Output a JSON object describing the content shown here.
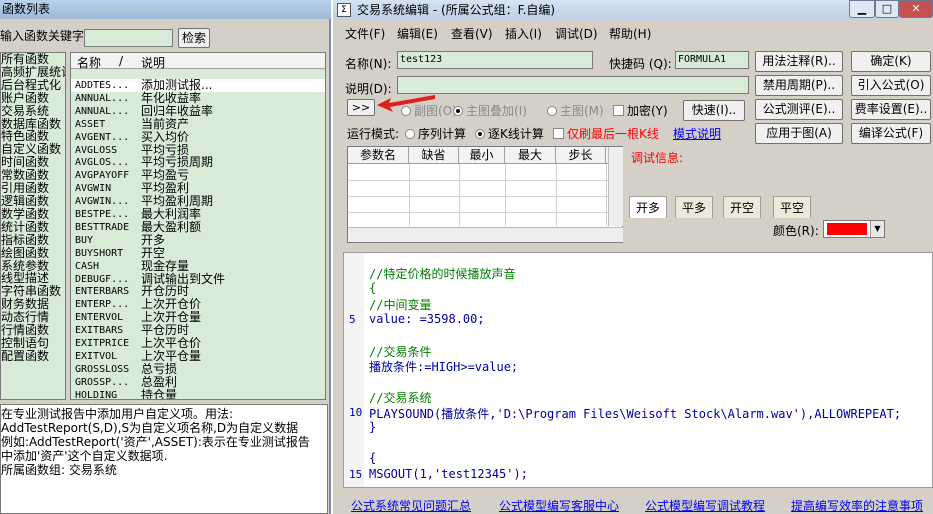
{
  "left": {
    "title": "函数列表",
    "search_label": "输入函数关键字",
    "search_value": "",
    "search_button": "检索",
    "categories": [
      "所有函数",
      "高频扩展统计",
      "后台程式化",
      "账户函数",
      "交易系统",
      "数据库函数",
      "特色函数",
      "自定义函数",
      "时间函数",
      "常数函数",
      "引用函数",
      "逻辑函数",
      "数学函数",
      "统计函数",
      "指标函数",
      "绘图函数",
      "系统参数",
      "线型描述",
      "字符串函数",
      "财务数据",
      "动态行情",
      "行情函数",
      "控制语句",
      "配置函数"
    ],
    "list_header_name": "名称",
    "list_header_slash": "/",
    "list_header_desc": "说明",
    "functions": [
      {
        "name": "ADDTES...",
        "desc": "添加测试报..."
      },
      {
        "name": "ANNUAL...",
        "desc": "年化收益率"
      },
      {
        "name": "ANNUAL...",
        "desc": "回归年收益率"
      },
      {
        "name": "ASSET",
        "desc": "当前资产"
      },
      {
        "name": "AVGENT...",
        "desc": "买入均价"
      },
      {
        "name": "AVGLOSS",
        "desc": "平均亏损"
      },
      {
        "name": "AVGLOS...",
        "desc": "平均亏损周期"
      },
      {
        "name": "AVGPAYOFF",
        "desc": "平均盈亏"
      },
      {
        "name": "AVGWIN",
        "desc": "平均盈利"
      },
      {
        "name": "AVGWIN...",
        "desc": "平均盈利周期"
      },
      {
        "name": "BESTPE...",
        "desc": "最大利润率"
      },
      {
        "name": "BESTTRADE",
        "desc": "最大盈利额"
      },
      {
        "name": "BUY",
        "desc": "开多"
      },
      {
        "name": "BUYSHORT",
        "desc": "开空"
      },
      {
        "name": "CASH",
        "desc": "现金存量"
      },
      {
        "name": "DEBUGF...",
        "desc": "调试输出到文件"
      },
      {
        "name": "ENTERBARS",
        "desc": "开仓历时"
      },
      {
        "name": "ENTERP...",
        "desc": "上次开仓价"
      },
      {
        "name": "ENTERVOL",
        "desc": "上次开仓量"
      },
      {
        "name": "EXITBARS",
        "desc": "平仓历时"
      },
      {
        "name": "EXITPRICE",
        "desc": "上次平仓价"
      },
      {
        "name": "EXITVOL",
        "desc": "上次平仓量"
      },
      {
        "name": "GROSSLOSS",
        "desc": "总亏损"
      },
      {
        "name": "GROSSP...",
        "desc": "总盈利"
      },
      {
        "name": "HOLDING",
        "desc": "持仓量"
      }
    ],
    "desc_lines": [
      "在专业测试报告中添加用户自定义项。用法:",
      "AddTestReport(S,D),S为自定义项名称,D为自定义数据",
      "例如:AddTestReport('资产',ASSET):表示在专业测试报告",
      "中添加'资产'这个自定义数据项.",
      "所属函数组: 交易系统"
    ]
  },
  "right": {
    "title": "交易系统编辑 - (所属公式组：F.自编)",
    "window_buttons": {
      "min": "▁",
      "max": "□",
      "close": "✕"
    },
    "menu": [
      "文件(F)",
      "编辑(E)",
      "查看(V)",
      "插入(I)",
      "调试(D)",
      "帮助(H)"
    ],
    "name_label": "名称(N):",
    "name_value": "test123",
    "shortcut_label": "快捷码 (Q):",
    "shortcut_value": "FORMULA1",
    "desc_label": "说明(D):",
    "desc_value": "",
    "expand_button": ">>",
    "opt_subplot": "副图(O)",
    "opt_main_overlay": "主图叠加(I)",
    "opt_main": "主图(M)",
    "opt_encrypt": "加密(Y)",
    "quick_button": "快速(I)..",
    "run_mode_label": "运行模式:",
    "run_seq": "序列计算",
    "run_tick": "逐K线计算",
    "refresh_last": "仅刷最后一根K线",
    "mode_help": "模式说明",
    "param_headers": [
      "参数名",
      "缺省",
      "最小",
      "最大",
      "步长"
    ],
    "debug_label": "调试信息:",
    "tabs": [
      "开多",
      "平多",
      "开空",
      "平空"
    ],
    "color_label": "颜色(R):",
    "color_value": "#ff0000",
    "buttons_col1": [
      "用法注释(R)..",
      "禁用周期(P)..",
      "公式测评(E)..",
      "应用于图(A)"
    ],
    "buttons_col2": [
      "确定(K)",
      "引入公式(O)",
      "费率设置(E)..",
      "编译公式(F)"
    ],
    "code_lines": [
      {
        "num": "",
        "text": "//特定价格的时候播放声音",
        "cls": "comment"
      },
      {
        "num": "",
        "text": "{",
        "cls": "comment"
      },
      {
        "num": "",
        "text": "//中间变量",
        "cls": "comment"
      },
      {
        "num": "5",
        "text": "value: =3598.00;",
        "cls": "kw"
      },
      {
        "num": "",
        "text": "",
        "cls": "kw"
      },
      {
        "num": "",
        "text": "//交易条件",
        "cls": "comment"
      },
      {
        "num": "",
        "text": "播放条件:=HIGH>=value;",
        "cls": "kw"
      },
      {
        "num": "",
        "text": "",
        "cls": "kw"
      },
      {
        "num": "",
        "text": "//交易系统",
        "cls": "comment"
      },
      {
        "num": "10",
        "text": "PLAYSOUND(播放条件,'D:\\Program Files\\Weisoft Stock\\Alarm.wav'),ALLOWREPEAT;",
        "cls": "kw"
      },
      {
        "num": "",
        "text": "}",
        "cls": "kw"
      },
      {
        "num": "",
        "text": "",
        "cls": "kw"
      },
      {
        "num": "",
        "text": "{",
        "cls": "kw"
      },
      {
        "num": "15",
        "text": "MSGOUT(1,'test12345');",
        "cls": "kw"
      }
    ],
    "bottom_links": [
      "公式系统常见问题汇总",
      "公式模型编写客服中心",
      "公式模型编写调试教程",
      "提高编写效率的注意事项"
    ]
  },
  "colors": {
    "accent": "#ff0000",
    "link": "#0000ee",
    "list_bg": "#d7ebd7"
  }
}
